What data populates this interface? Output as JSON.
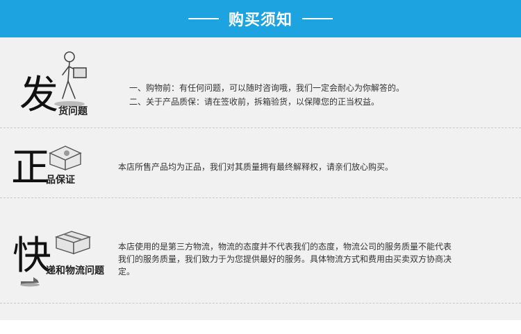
{
  "header": {
    "title": "购买须知"
  },
  "sections": [
    {
      "big_char": "发",
      "sub_label": "货问题",
      "lines": [
        "一、购物前：有任何问题，可以随时咨询哦，我们一定会耐心为你解答的。",
        "二、关于产品质保：请在签收前，拆箱验货，以保障您的正当权益。"
      ]
    },
    {
      "big_char": "正",
      "sub_label": "品保证",
      "lines": [
        "本店所售产品均为正品，我们对其质量拥有最终解释权，请亲们放心购买。"
      ]
    },
    {
      "big_char": "快",
      "sub_label": "递和物流问题",
      "lines": [
        "本店使用的是第三方物流，物流的态度并不代表我们的态度，物流公司的服务质量不能代表",
        "我们的服务质量，我们致力于为您提供最好的服务。具体物流方式和费用由买卖双方协商决",
        "定。"
      ]
    }
  ]
}
